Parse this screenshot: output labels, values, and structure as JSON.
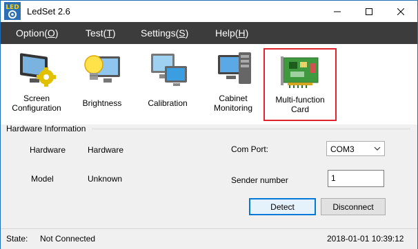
{
  "window": {
    "title": "LedSet 2.6",
    "icon_text": "LED",
    "icon": "ledset-app-icon"
  },
  "menu": [
    {
      "label": "Option(",
      "key": "O",
      "suffix": ")"
    },
    {
      "label": "Test(",
      "key": "T",
      "suffix": ")"
    },
    {
      "label": "Settings(",
      "key": "S",
      "suffix": ")"
    },
    {
      "label": "Help(",
      "key": "H",
      "suffix": ")"
    }
  ],
  "toolbar": [
    {
      "line1": "Screen",
      "line2": "Configuration",
      "icon": "monitor-gear-icon"
    },
    {
      "line1": "Brightness",
      "line2": "",
      "icon": "lightbulb-monitor-icon"
    },
    {
      "line1": "Calibration",
      "line2": "",
      "icon": "calibration-monitors-icon"
    },
    {
      "line1": "Cabinet",
      "line2": "Monitoring",
      "icon": "cabinet-monitor-icon"
    },
    {
      "line1": "Multi-function",
      "line2": "Card",
      "icon": "circuit-card-icon",
      "highlighted": true
    }
  ],
  "hardware": {
    "group_title": "Hardware Information",
    "hardware_label": "Hardware",
    "hardware_value": "Hardware",
    "model_label": "Model",
    "model_value": "Unknown",
    "com_port_label": "Com Port:",
    "com_port_value": "COM3",
    "sender_label": "Sender number",
    "sender_value": "1",
    "detect_label": "Detect",
    "disconnect_label": "Disconnect"
  },
  "status": {
    "label": "State:",
    "value": "Not Connected",
    "datetime": "2018-01-01 10:39:12"
  },
  "colors": {
    "menubar": "#3c3c3c",
    "highlight_border": "#e0232a",
    "accent": "#0078d7"
  }
}
